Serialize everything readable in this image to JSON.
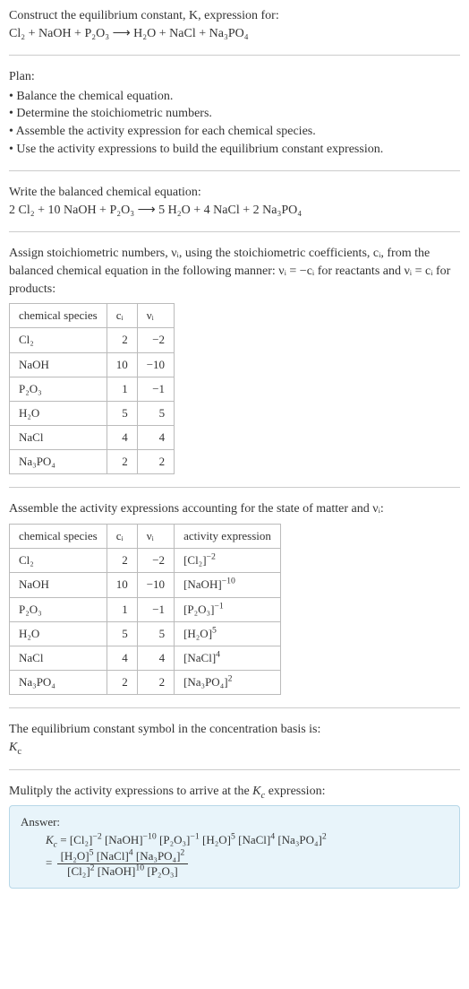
{
  "intro": {
    "line1": "Construct the equilibrium constant, K, expression for:",
    "equation": "Cl₂ + NaOH + P₂O₃  ⟶  H₂O + NaCl + Na₃PO₄"
  },
  "plan": {
    "heading": "Plan:",
    "items": [
      "Balance the chemical equation.",
      "Determine the stoichiometric numbers.",
      "Assemble the activity expression for each chemical species.",
      "Use the activity expressions to build the equilibrium constant expression."
    ]
  },
  "balanced": {
    "heading": "Write the balanced chemical equation:",
    "equation": "2 Cl₂ + 10 NaOH + P₂O₃  ⟶  5 H₂O + 4 NaCl + 2 Na₃PO₄"
  },
  "stoich": {
    "heading": "Assign stoichiometric numbers, νᵢ, using the stoichiometric coefficients, cᵢ, from the balanced chemical equation in the following manner: νᵢ = −cᵢ for reactants and νᵢ = cᵢ for products:",
    "headers": [
      "chemical species",
      "cᵢ",
      "νᵢ"
    ],
    "rows": [
      {
        "species": "Cl₂",
        "c": "2",
        "v": "−2"
      },
      {
        "species": "NaOH",
        "c": "10",
        "v": "−10"
      },
      {
        "species": "P₂O₃",
        "c": "1",
        "v": "−1"
      },
      {
        "species": "H₂O",
        "c": "5",
        "v": "5"
      },
      {
        "species": "NaCl",
        "c": "4",
        "v": "4"
      },
      {
        "species": "Na₃PO₄",
        "c": "2",
        "v": "2"
      }
    ]
  },
  "activity": {
    "heading": "Assemble the activity expressions accounting for the state of matter and νᵢ:",
    "headers": [
      "chemical species",
      "cᵢ",
      "νᵢ",
      "activity expression"
    ],
    "rows": [
      {
        "species": "Cl₂",
        "c": "2",
        "v": "−2",
        "expr_base": "[Cl₂]",
        "expr_pow": "−2"
      },
      {
        "species": "NaOH",
        "c": "10",
        "v": "−10",
        "expr_base": "[NaOH]",
        "expr_pow": "−10"
      },
      {
        "species": "P₂O₃",
        "c": "1",
        "v": "−1",
        "expr_base": "[P₂O₃]",
        "expr_pow": "−1"
      },
      {
        "species": "H₂O",
        "c": "5",
        "v": "5",
        "expr_base": "[H₂O]",
        "expr_pow": "5"
      },
      {
        "species": "NaCl",
        "c": "4",
        "v": "4",
        "expr_base": "[NaCl]",
        "expr_pow": "4"
      },
      {
        "species": "Na₃PO₄",
        "c": "2",
        "v": "2",
        "expr_base": "[Na₃PO₄]",
        "expr_pow": "2"
      }
    ]
  },
  "symbol": {
    "line1": "The equilibrium constant symbol in the concentration basis is:",
    "line2_base": "K",
    "line2_sub": "c"
  },
  "multiply": {
    "heading": "Mulitply the activity expressions to arrive at the K_c expression:"
  },
  "answer": {
    "label": "Answer:",
    "prefix": "K_c = ",
    "line1_terms": [
      {
        "base": "[Cl₂]",
        "pow": "−2"
      },
      {
        "base": "[NaOH]",
        "pow": "−10"
      },
      {
        "base": "[P₂O₃]",
        "pow": "−1"
      },
      {
        "base": "[H₂O]",
        "pow": "5"
      },
      {
        "base": "[NaCl]",
        "pow": "4"
      },
      {
        "base": "[Na₃PO₄]",
        "pow": "2"
      }
    ],
    "eq": "= ",
    "numerator_terms": [
      {
        "base": "[H₂O]",
        "pow": "5"
      },
      {
        "base": "[NaCl]",
        "pow": "4"
      },
      {
        "base": "[Na₃PO₄]",
        "pow": "2"
      }
    ],
    "denominator_terms": [
      {
        "base": "[Cl₂]",
        "pow": "2"
      },
      {
        "base": "[NaOH]",
        "pow": "10"
      },
      {
        "base": "[P₂O₃]",
        "pow": ""
      }
    ]
  }
}
